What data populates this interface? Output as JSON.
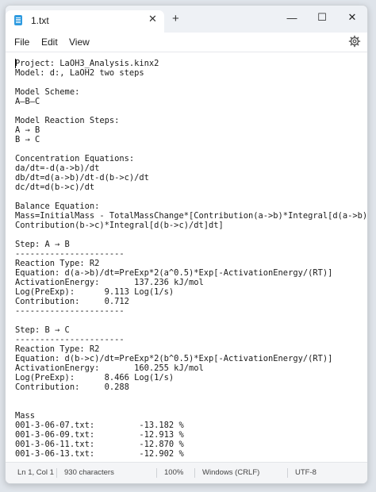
{
  "window": {
    "tab_title": "1.txt",
    "tab_close_glyph": "✕",
    "new_tab_glyph": "+",
    "minimize_glyph": "—",
    "maximize_glyph": "☐",
    "close_glyph": "✕"
  },
  "menu": {
    "file": "File",
    "edit": "Edit",
    "view": "View"
  },
  "editor": {
    "lines": [
      "Project: LaOH3_Analysis.kinx2",
      "Model: d:, LaOH2 two steps",
      "",
      "Model Scheme:",
      "A—B—C",
      "",
      "Model Reaction Steps:",
      "A → B",
      "B → C",
      "",
      "Concentration Equations:",
      "da/dt=-d(a->b)/dt",
      "db/dt=d(a->b)/dt-d(b->c)/dt",
      "dc/dt=d(b->c)/dt",
      "",
      "Balance Equation:",
      "Mass=InitialMass - TotalMassChange*[Contribution(a->b)*Integral[d(a->b)/dt]dt +",
      "Contribution(b->c)*Integral[d(b->c)/dt]dt]",
      "",
      "Step: A → B",
      "----------------------",
      "Reaction Type: R2",
      "Equation: d(a->b)/dt=PreExp*2(a^0.5)*Exp[-ActivationEnergy/(RT)]",
      "ActivationEnergy:       137.236 kJ/mol",
      "Log(PreExp):      9.113 Log(1/s)",
      "Contribution:     0.712",
      "----------------------",
      "",
      "Step: B → C",
      "----------------------",
      "Reaction Type: R2",
      "Equation: d(b->c)/dt=PreExp*2(b^0.5)*Exp[-ActivationEnergy/(RT)]",
      "ActivationEnergy:       160.255 kJ/mol",
      "Log(PreExp):      8.466 Log(1/s)",
      "Contribution:     0.288",
      "",
      "",
      "Mass",
      "001-3-06-07.txt:         -13.182 %",
      "001-3-06-09.txt:         -12.913 %",
      "001-3-06-11.txt:         -12.870 %",
      "001-3-06-13.txt:         -12.902 %"
    ]
  },
  "status": {
    "position": "Ln 1, Col 1",
    "characters": "930 characters",
    "zoom": "100%",
    "line_ending": "Windows (CRLF)",
    "encoding": "UTF-8"
  },
  "icons": {
    "settings": "gear-icon",
    "app": "notepad-icon"
  }
}
